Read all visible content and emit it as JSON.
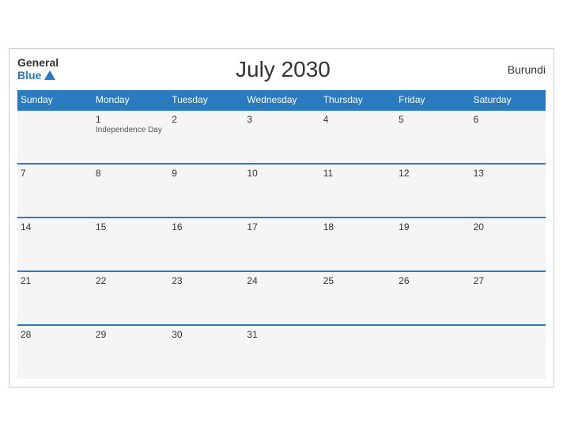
{
  "header": {
    "logo_general": "General",
    "logo_blue": "Blue",
    "title": "July 2030",
    "country": "Burundi"
  },
  "days": [
    "Sunday",
    "Monday",
    "Tuesday",
    "Wednesday",
    "Thursday",
    "Friday",
    "Saturday"
  ],
  "weeks": [
    [
      {
        "day": "",
        "holiday": ""
      },
      {
        "day": "1",
        "holiday": "Independence Day"
      },
      {
        "day": "2",
        "holiday": ""
      },
      {
        "day": "3",
        "holiday": ""
      },
      {
        "day": "4",
        "holiday": ""
      },
      {
        "day": "5",
        "holiday": ""
      },
      {
        "day": "6",
        "holiday": ""
      }
    ],
    [
      {
        "day": "7",
        "holiday": ""
      },
      {
        "day": "8",
        "holiday": ""
      },
      {
        "day": "9",
        "holiday": ""
      },
      {
        "day": "10",
        "holiday": ""
      },
      {
        "day": "11",
        "holiday": ""
      },
      {
        "day": "12",
        "holiday": ""
      },
      {
        "day": "13",
        "holiday": ""
      }
    ],
    [
      {
        "day": "14",
        "holiday": ""
      },
      {
        "day": "15",
        "holiday": ""
      },
      {
        "day": "16",
        "holiday": ""
      },
      {
        "day": "17",
        "holiday": ""
      },
      {
        "day": "18",
        "holiday": ""
      },
      {
        "day": "19",
        "holiday": ""
      },
      {
        "day": "20",
        "holiday": ""
      }
    ],
    [
      {
        "day": "21",
        "holiday": ""
      },
      {
        "day": "22",
        "holiday": ""
      },
      {
        "day": "23",
        "holiday": ""
      },
      {
        "day": "24",
        "holiday": ""
      },
      {
        "day": "25",
        "holiday": ""
      },
      {
        "day": "26",
        "holiday": ""
      },
      {
        "day": "27",
        "holiday": ""
      }
    ],
    [
      {
        "day": "28",
        "holiday": ""
      },
      {
        "day": "29",
        "holiday": ""
      },
      {
        "day": "30",
        "holiday": ""
      },
      {
        "day": "31",
        "holiday": ""
      },
      {
        "day": "",
        "holiday": ""
      },
      {
        "day": "",
        "holiday": ""
      },
      {
        "day": "",
        "holiday": ""
      }
    ]
  ]
}
